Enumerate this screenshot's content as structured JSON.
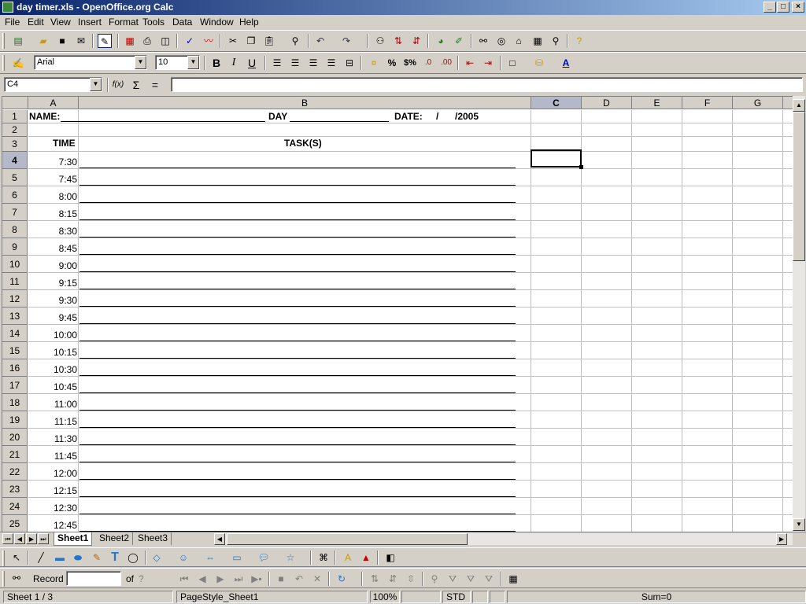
{
  "window": {
    "title": "day timer.xls - OpenOffice.org Calc",
    "min": "_",
    "max": "□",
    "close": "×"
  },
  "menu": [
    "File",
    "Edit",
    "View",
    "Insert",
    "Format",
    "Tools",
    "Data",
    "Window",
    "Help"
  ],
  "format_toolbar": {
    "font": "Arial",
    "size": "10",
    "bold": "B",
    "italic": "I",
    "underline": "U",
    "percent": "%",
    "currency": "$%",
    "dec_add": ".0",
    "dec_del": ".00"
  },
  "formula_bar": {
    "cell_ref": "C4",
    "func_icon": "f(x)",
    "sum_icon": "Σ",
    "equals_icon": "=",
    "formula": ""
  },
  "columns": [
    "A",
    "B",
    "C",
    "D",
    "E",
    "F",
    "G"
  ],
  "selected_column": "C",
  "selected_row": "4",
  "rows": [
    "1",
    "2",
    "3",
    "4",
    "5",
    "6",
    "7",
    "8",
    "9",
    "10",
    "11",
    "12",
    "13",
    "14",
    "15",
    "16",
    "17",
    "18",
    "19",
    "20",
    "21",
    "22",
    "23",
    "24",
    "25"
  ],
  "sheet": {
    "name_label": "NAME:",
    "day_label": "DAY",
    "date_label": "DATE:",
    "date_sep": "/",
    "year": "/2005",
    "time_header": "TIME",
    "task_header": "TASK(S)",
    "times": [
      "7:30",
      "7:45",
      "8:00",
      "8:15",
      "8:30",
      "8:45",
      "9:00",
      "9:15",
      "9:30",
      "9:45",
      "10:00",
      "10:15",
      "10:30",
      "10:45",
      "11:00",
      "11:15",
      "11:30",
      "11:45",
      "12:00",
      "12:15",
      "12:30",
      "12:45"
    ]
  },
  "tabs": [
    "Sheet1",
    "Sheet2",
    "Sheet3"
  ],
  "active_tab": "Sheet1",
  "navbar": {
    "record_label": "Record",
    "of_label": "of",
    "count": "?"
  },
  "status": {
    "sheet": "Sheet 1 / 3",
    "pagestyle": "PageStyle_Sheet1",
    "zoom": "100%",
    "mode": "STD",
    "sum": "Sum=0"
  },
  "colors": {
    "title_start": "#0a246a",
    "title_end": "#a6caf0",
    "chrome": "#d4d0c8",
    "selected_header": "#b4b8c8"
  }
}
